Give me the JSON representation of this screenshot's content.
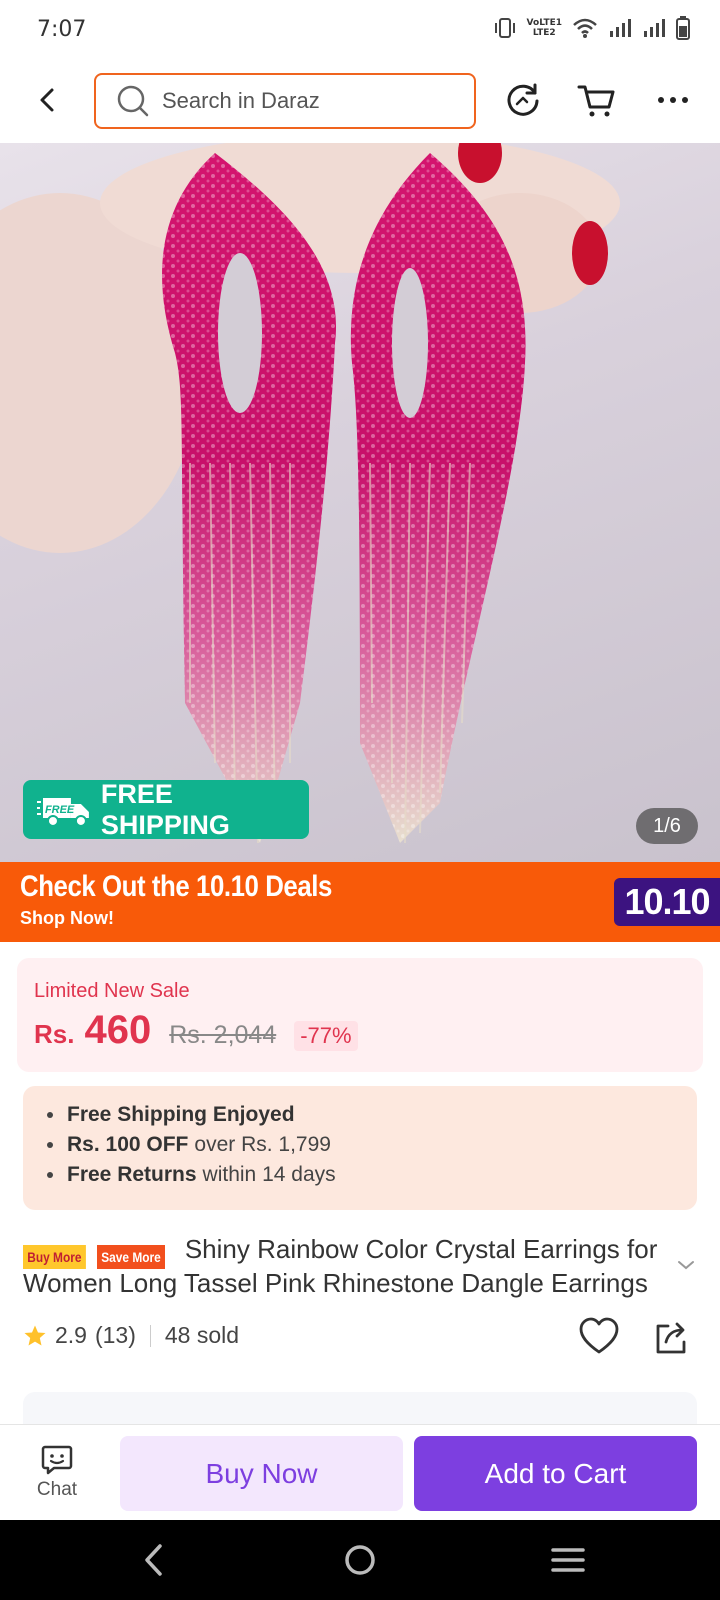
{
  "status_bar": {
    "time": "7:07",
    "lte_label_top": "VoLTE1",
    "lte_label_bottom": "LTE2"
  },
  "header": {
    "search_placeholder": "Search in Daraz"
  },
  "product_image": {
    "free_shipping_label": "FREE SHIPPING",
    "free_tag": "FREE",
    "counter": "1/6"
  },
  "promo_banner": {
    "title": "Check Out the 10.10 Deals",
    "subtitle": "Shop Now!",
    "badge": "10.10"
  },
  "price": {
    "sale_label": "Limited New Sale",
    "currency": "Rs.",
    "current": "460",
    "original": "Rs. 2,044",
    "discount": "-77%"
  },
  "benefits": [
    {
      "bold": "Free Shipping Enjoyed",
      "rest": ""
    },
    {
      "bold": "Rs. 100 OFF",
      "rest": "over Rs. 1,799"
    },
    {
      "bold": "Free Returns",
      "rest": "within 14 days"
    }
  ],
  "title": {
    "badge_left": "Buy More",
    "badge_right": "Save More",
    "text": "Shiny Rainbow Color Crystal Earrings for Women Long Tassel Pink Rhinestone Dangle Earrings"
  },
  "rating": {
    "score": "2.9",
    "count": "(13)",
    "sold": "48 sold"
  },
  "action_bar": {
    "chat_label": "Chat",
    "buy_now": "Buy Now",
    "add_to_cart": "Add to Cart"
  },
  "colors": {
    "brand_orange": "#f85a09",
    "price_red": "#e0344e",
    "primary_purple": "#7d3fe0",
    "free_ship_green": "#10b28e"
  }
}
